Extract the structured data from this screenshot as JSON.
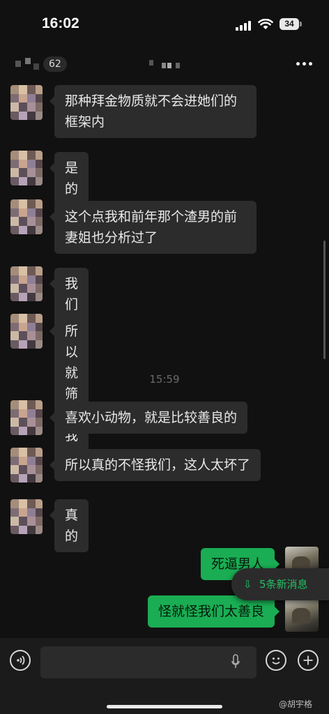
{
  "status": {
    "time": "16:02",
    "battery": "34"
  },
  "header": {
    "unread_badge": "62",
    "more_icon": "more-dots-icon"
  },
  "messages": [
    {
      "sender": "other",
      "text": "那种拜金物质就不会进她们的框架内"
    },
    {
      "sender": "other",
      "text": "是的"
    },
    {
      "sender": "other",
      "text": "这个点我和前年那个渣男的前妻姐也分析过了"
    },
    {
      "sender": "other",
      "text": "我们爱买单"
    },
    {
      "sender": "other",
      "text": "所以就筛选我们"
    },
    {
      "sender": "other",
      "text": "喜欢小动物，就是比较善良的"
    },
    {
      "sender": "other",
      "text": "所以真的不怪我们，这人太坏了"
    },
    {
      "sender": "other",
      "text": "真的"
    },
    {
      "sender": "me",
      "text": "死逼男人"
    },
    {
      "sender": "me",
      "text": "怪就怪我们太善良"
    }
  ],
  "timestamp": "15:59",
  "new_messages_label": "5条新消息",
  "input": {
    "value": "",
    "placeholder": ""
  },
  "watermark": "@胡宇格",
  "colors": {
    "background": "#111111",
    "my_bubble": "#1aad53",
    "other_bubble": "#2c2c2c",
    "accent": "#21c064"
  }
}
